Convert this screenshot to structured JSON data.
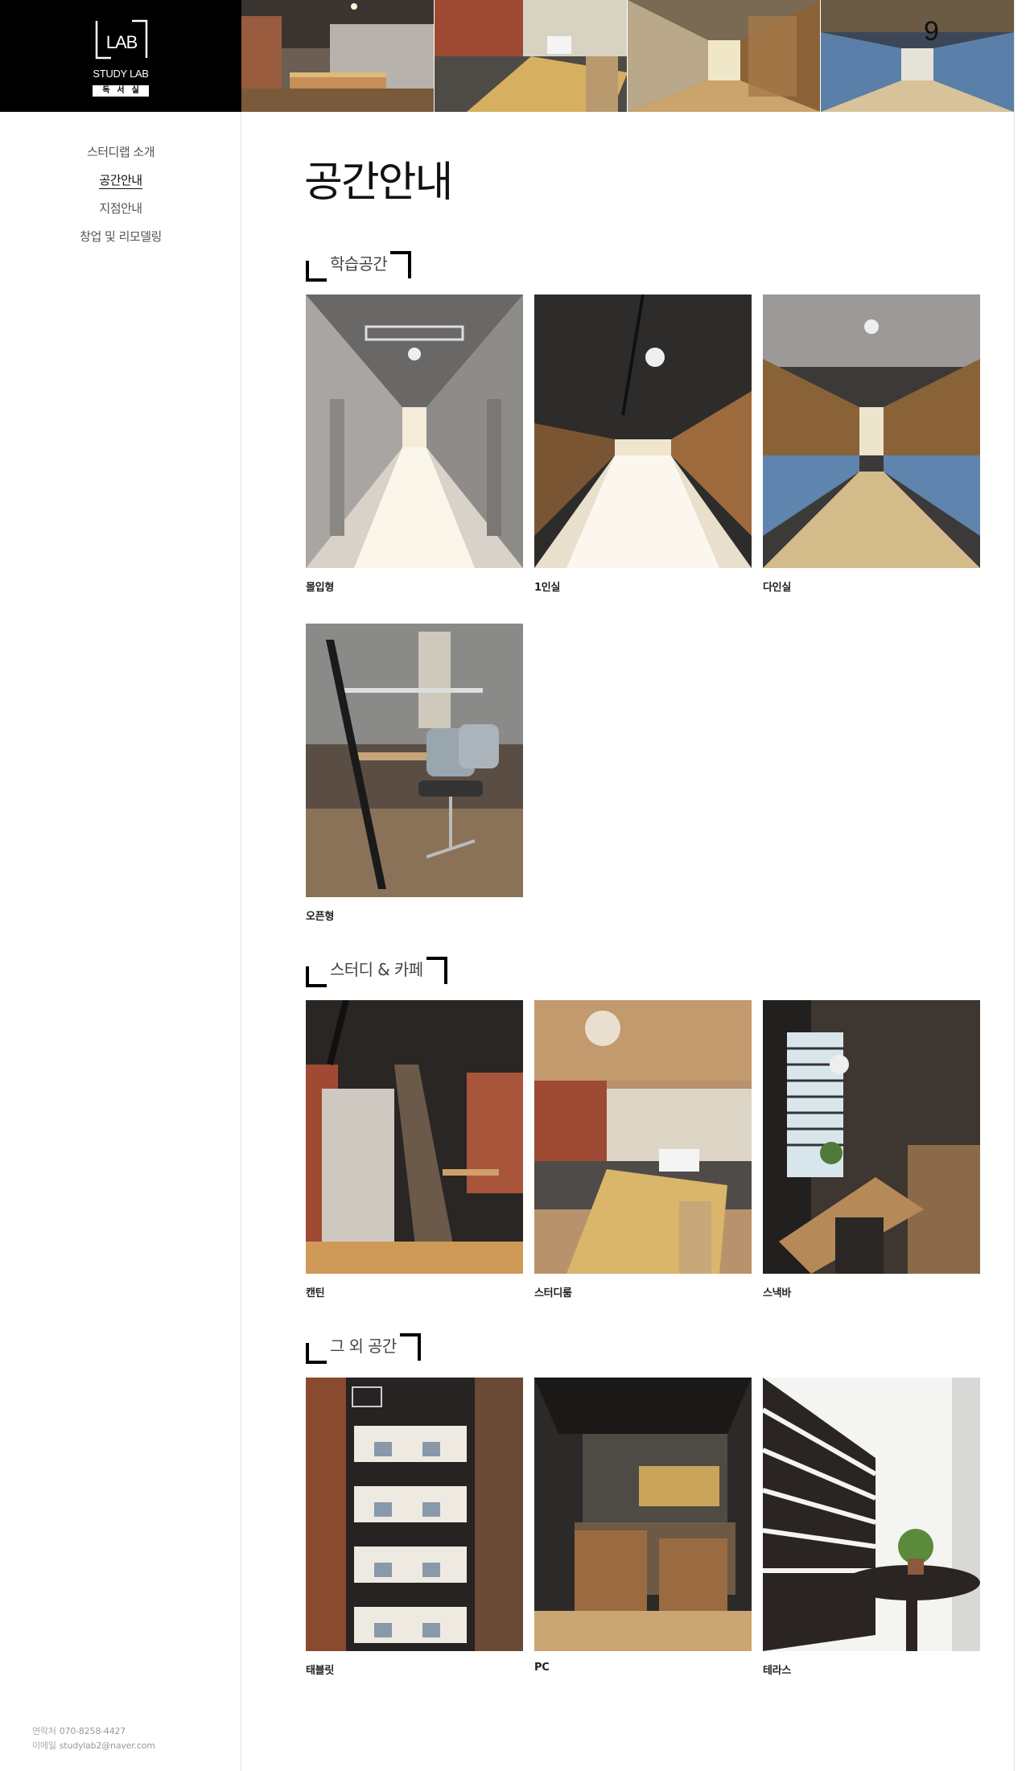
{
  "brand": {
    "logo_text": "LAB",
    "name_en": "STUDY LAB",
    "name_ko": "독서실"
  },
  "nav": [
    {
      "label": "스터디랩 소개",
      "active": false
    },
    {
      "label": "공간안내",
      "active": true
    },
    {
      "label": "지점안내",
      "active": false
    },
    {
      "label": "창업 및 리모델링",
      "active": false
    }
  ],
  "page": {
    "title": "공간안내"
  },
  "sections": [
    {
      "title": "학습공간",
      "items": [
        {
          "caption": "몰입형"
        },
        {
          "caption": "1인실"
        },
        {
          "caption": "다인실"
        },
        {
          "caption": "오픈형"
        }
      ]
    },
    {
      "title": "스터디 & 카페",
      "items": [
        {
          "caption": "캔틴"
        },
        {
          "caption": "스터디룸"
        },
        {
          "caption": "스낵바"
        }
      ]
    },
    {
      "title": "그 외 공간",
      "items": [
        {
          "caption": "태블릿"
        },
        {
          "caption": "PC"
        },
        {
          "caption": "테라스"
        }
      ]
    }
  ],
  "footer": {
    "phone_label": "연락처",
    "phone": "070-8258-4427",
    "email_label": "이메일",
    "email": "studylab2@naver.com"
  },
  "colors": {
    "logo_bg": "#000000",
    "accent": "#000000",
    "text": "#222222"
  }
}
